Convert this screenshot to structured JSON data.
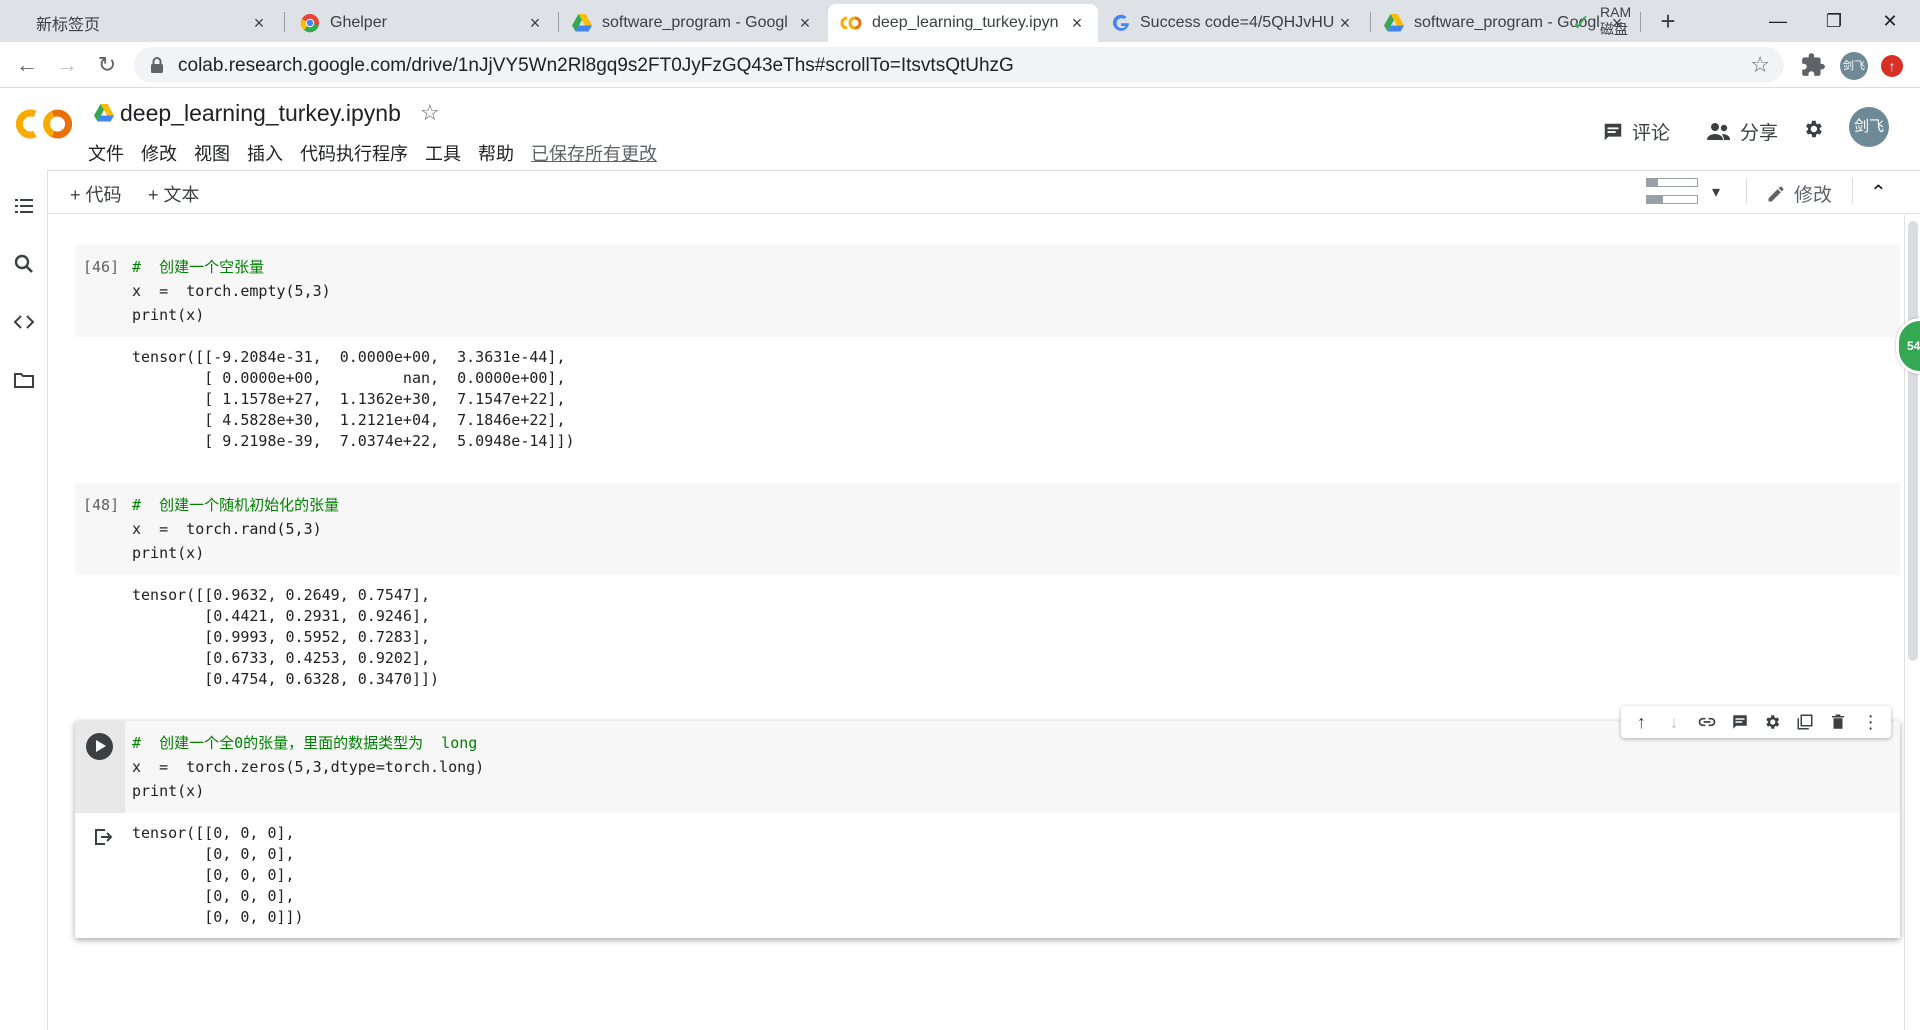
{
  "browser": {
    "tabs": [
      {
        "title": "新标签页",
        "close": "×",
        "active": false
      },
      {
        "title": "Ghelper",
        "close": "×",
        "active": false
      },
      {
        "title": "software_program - Googl",
        "close": "×",
        "active": false
      },
      {
        "title": "deep_learning_turkey.ipyn",
        "close": "×",
        "active": true
      },
      {
        "title": "Success code=4/5QHJvHU",
        "close": "×",
        "active": false
      },
      {
        "title": "software_program - Googl",
        "close": "×",
        "active": false
      }
    ],
    "new_tab": "+",
    "window_controls": {
      "minimize": "—",
      "restore": "❐",
      "close": "✕"
    },
    "url": "colab.research.google.com/drive/1nJjVY5Wn2Rl8gq9s2FT0JyFzGQ43eThs#scrollTo=ItsvtsQtUhzG",
    "profile_initials": "剑飞",
    "update_badge": "↑"
  },
  "colab": {
    "title": "deep_learning_turkey.ipynb",
    "menu": [
      "文件",
      "修改",
      "视图",
      "插入",
      "代码执行程序",
      "工具",
      "帮助"
    ],
    "saved_status": "已保存所有更改",
    "comment_label": "评论",
    "share_label": "分享",
    "user_initials": "剑飞"
  },
  "toolbar": {
    "add_code": "+ 代码",
    "add_text": "+ 文本",
    "ram_label": "RAM",
    "disk_label": "磁盘",
    "ram_fill": 0.22,
    "disk_fill": 0.32,
    "edit_label": "修改"
  },
  "cells": [
    {
      "exec_count": "[46]",
      "code": [
        {
          "comment": "#  创建一个空张量"
        },
        {
          "text": "x  =  torch.empty(5,3)"
        },
        {
          "text": "print(x)"
        }
      ],
      "output": "tensor([[-9.2084e-31,  0.0000e+00,  3.3631e-44],\n        [ 0.0000e+00,         nan,  0.0000e+00],\n        [ 1.1578e+27,  1.1362e+30,  7.1547e+22],\n        [ 4.5828e+30,  1.2121e+04,  7.1846e+22],\n        [ 9.2198e-39,  7.0374e+22,  5.0948e-14]])"
    },
    {
      "exec_count": "[48]",
      "code": [
        {
          "comment": "#  创建一个随机初始化的张量"
        },
        {
          "text": "x  =  torch.rand(5,3)"
        },
        {
          "text": "print(x)"
        }
      ],
      "output": "tensor([[0.9632, 0.2649, 0.7547],\n        [0.4421, 0.2931, 0.9246],\n        [0.9993, 0.5952, 0.7283],\n        [0.6733, 0.4253, 0.9202],\n        [0.4754, 0.6328, 0.3470]])"
    },
    {
      "exec_count": "",
      "code": [
        {
          "comment": "#  创建一个全0的张量，里面的数据类型为  long"
        },
        {
          "text": "x  =  torch.zeros(5,3,dtype=torch.long)"
        },
        {
          "text": "print(x)"
        }
      ],
      "output": "tensor([[0, 0, 0],\n        [0, 0, 0],\n        [0, 0, 0],\n        [0, 0, 0],\n        [0, 0, 0]])"
    }
  ],
  "floating_badge": "54"
}
